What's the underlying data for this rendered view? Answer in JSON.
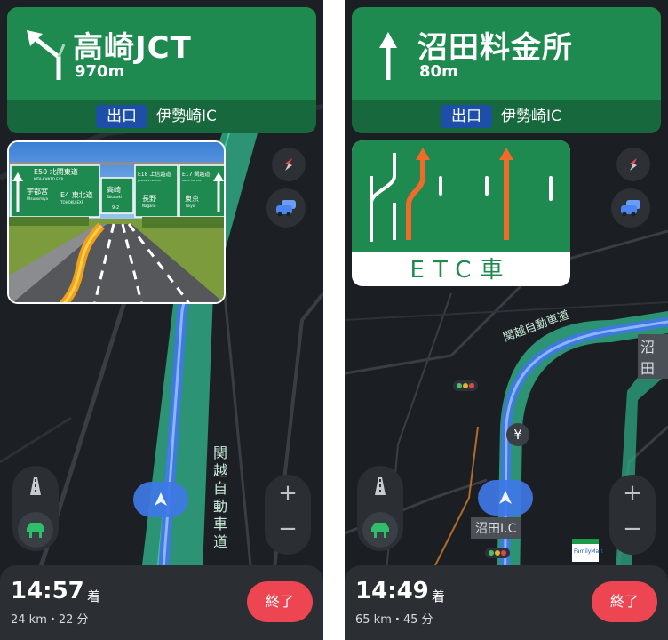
{
  "left_screen": {
    "banner": {
      "destination": "高崎JCT",
      "distance": "970m",
      "exit_badge": "出口",
      "exit_name": "伊勢崎IC"
    },
    "guide_sign": {
      "left_top": "E50 北関東道",
      "left_top_sub": "KITA-KANTO EXP",
      "left_city": "宇都宮",
      "left_city_sub": "Utsunomiya",
      "left_mid": "E4 東北道",
      "left_mid_sub": "TOHOKU EXP",
      "center_city": "高崎",
      "center_city_sub": "Takasaki",
      "center_code": "9-2",
      "right1_top": "E18 上信越道",
      "right1_top_sub": "JOSHIN-ETSU EXP",
      "right1_city": "長野",
      "right1_city_sub": "Nagano",
      "right2_top": "E17 関越道",
      "right2_top_sub": "KAN-ETSU EXP",
      "right2_city": "東京",
      "right2_city_sub": "Tokyo"
    },
    "road_label": "関越自動車道",
    "eta": {
      "time": "14:57",
      "suffix": "着",
      "trip": "24 km・22 分"
    },
    "end_button": "終了",
    "zoom_in": "+",
    "zoom_out": "−"
  },
  "right_screen": {
    "banner": {
      "destination": "沼田料金所",
      "distance": "80m",
      "exit_badge": "出口",
      "exit_name": "伊勢崎IC"
    },
    "etc_label": "ETC車",
    "road_label": "関越自動車道",
    "place_label_right": "沼田",
    "place_label": "沼田I.C",
    "eta": {
      "time": "14:49",
      "suffix": "着",
      "trip": "65 km・45 分"
    },
    "end_button": "終了",
    "zoom_in": "+",
    "zoom_out": "−",
    "store_label": "FamilyMart"
  },
  "colors": {
    "banner_green": "#1e8a4f",
    "exit_blue": "#1d4fa8",
    "end_red": "#ee4552",
    "route_blue": "#3f78e6",
    "road_teal": "#2fa882"
  },
  "icons": [
    "turn-left-arrow-icon",
    "straight-arrow-icon",
    "compass-icon",
    "traffic-car-icon",
    "highway-view-icon",
    "route-overview-icon",
    "current-location-icon",
    "toll-yen-icon",
    "traffic-light-icon"
  ]
}
